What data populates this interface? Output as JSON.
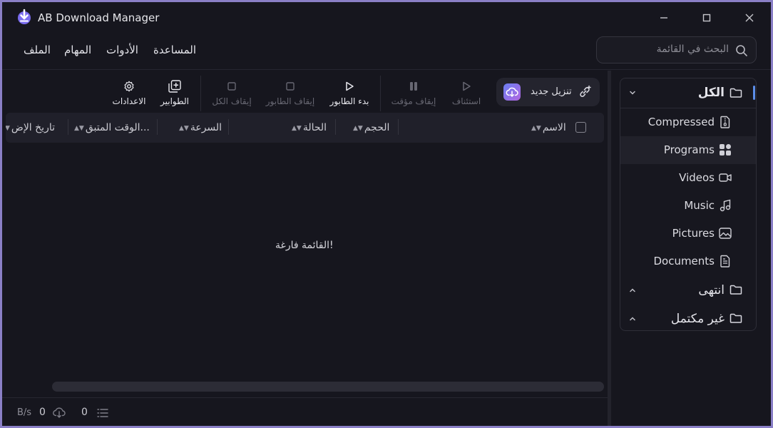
{
  "app": {
    "title": "AB Download Manager"
  },
  "menu": {
    "file": "الملف",
    "tasks": "المهام",
    "tools": "الأدوات",
    "help": "المساعدة"
  },
  "search": {
    "placeholder": "البحث في القائمة"
  },
  "sidebar": {
    "all": {
      "label": "الكل",
      "expanded": true
    },
    "subcategories": [
      "Compressed",
      "Programs",
      "Videos",
      "Music",
      "Pictures",
      "Documents"
    ],
    "active_subcategory": "Programs",
    "finished": {
      "label": "انتهى"
    },
    "unfinished": {
      "label": "غير مكتمل"
    }
  },
  "toolbar": {
    "new_download": "تنزيل جديد",
    "resume": "استئناف",
    "pause": "إيقاف مؤقت",
    "start_queue": "بدء الطابور",
    "stop_queue": "إيقاف الطابور",
    "stop_all": "إيقاف الكل",
    "queues": "الطوابير",
    "settings": "الاعدادات"
  },
  "table": {
    "columns": {
      "name": "الاسم",
      "size": "الحجم",
      "status": "الحالة",
      "speed": "السرعة",
      "time_left": "الوقت المتبق...",
      "date_added": "تاريخ الإض"
    },
    "empty_message": "القائمة فارغة!"
  },
  "status_bar": {
    "speed_value": "0",
    "speed_unit": "B/s",
    "count": "0"
  },
  "colors": {
    "background": "#16161e",
    "accent": "#5b8de8",
    "badge_start": "#6a7ff2",
    "badge_end": "#b166e0",
    "window_border": "#8a7fc6"
  }
}
